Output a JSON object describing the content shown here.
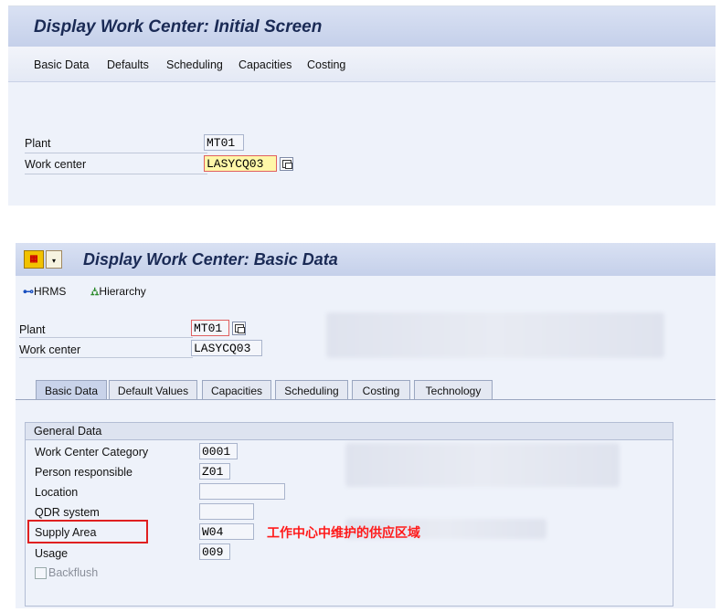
{
  "screen1": {
    "title": "Display Work Center: Initial Screen",
    "menu": [
      "Basic Data",
      "Defaults",
      "Scheduling",
      "Capacities",
      "Costing"
    ],
    "plant_label": "Plant",
    "plant_value": "MT01",
    "work_center_label": "Work center",
    "work_center_value": "LASYCQ03"
  },
  "screen2": {
    "title": "Display Work Center: Basic Data",
    "toolbar": {
      "hrms": "HRMS",
      "hierarchy": "Hierarchy"
    },
    "plant_label": "Plant",
    "plant_value": "MT01",
    "work_center_label": "Work center",
    "work_center_value": "LASYCQ03",
    "tabs": [
      "Basic Data",
      "Default Values",
      "Capacities",
      "Scheduling",
      "Costing",
      "Technology"
    ],
    "active_tab": "Basic Data",
    "group_title": "General Data",
    "fields": {
      "category_label": "Work Center Category",
      "category_value": "0001",
      "person_label": "Person responsible",
      "person_value": "Z01",
      "location_label": "Location",
      "location_value": "",
      "qdr_label": "QDR system",
      "qdr_value": "",
      "supply_label": "Supply Area",
      "supply_value": "W04",
      "usage_label": "Usage",
      "usage_value": "009",
      "backflush_label": "Backflush"
    },
    "annotation": "工作中心中维护的供应区域"
  },
  "colors": {
    "annotation": "#ff1a1a",
    "title_bar": "#c5d0ea",
    "highlight_field": "#fff7a8"
  }
}
